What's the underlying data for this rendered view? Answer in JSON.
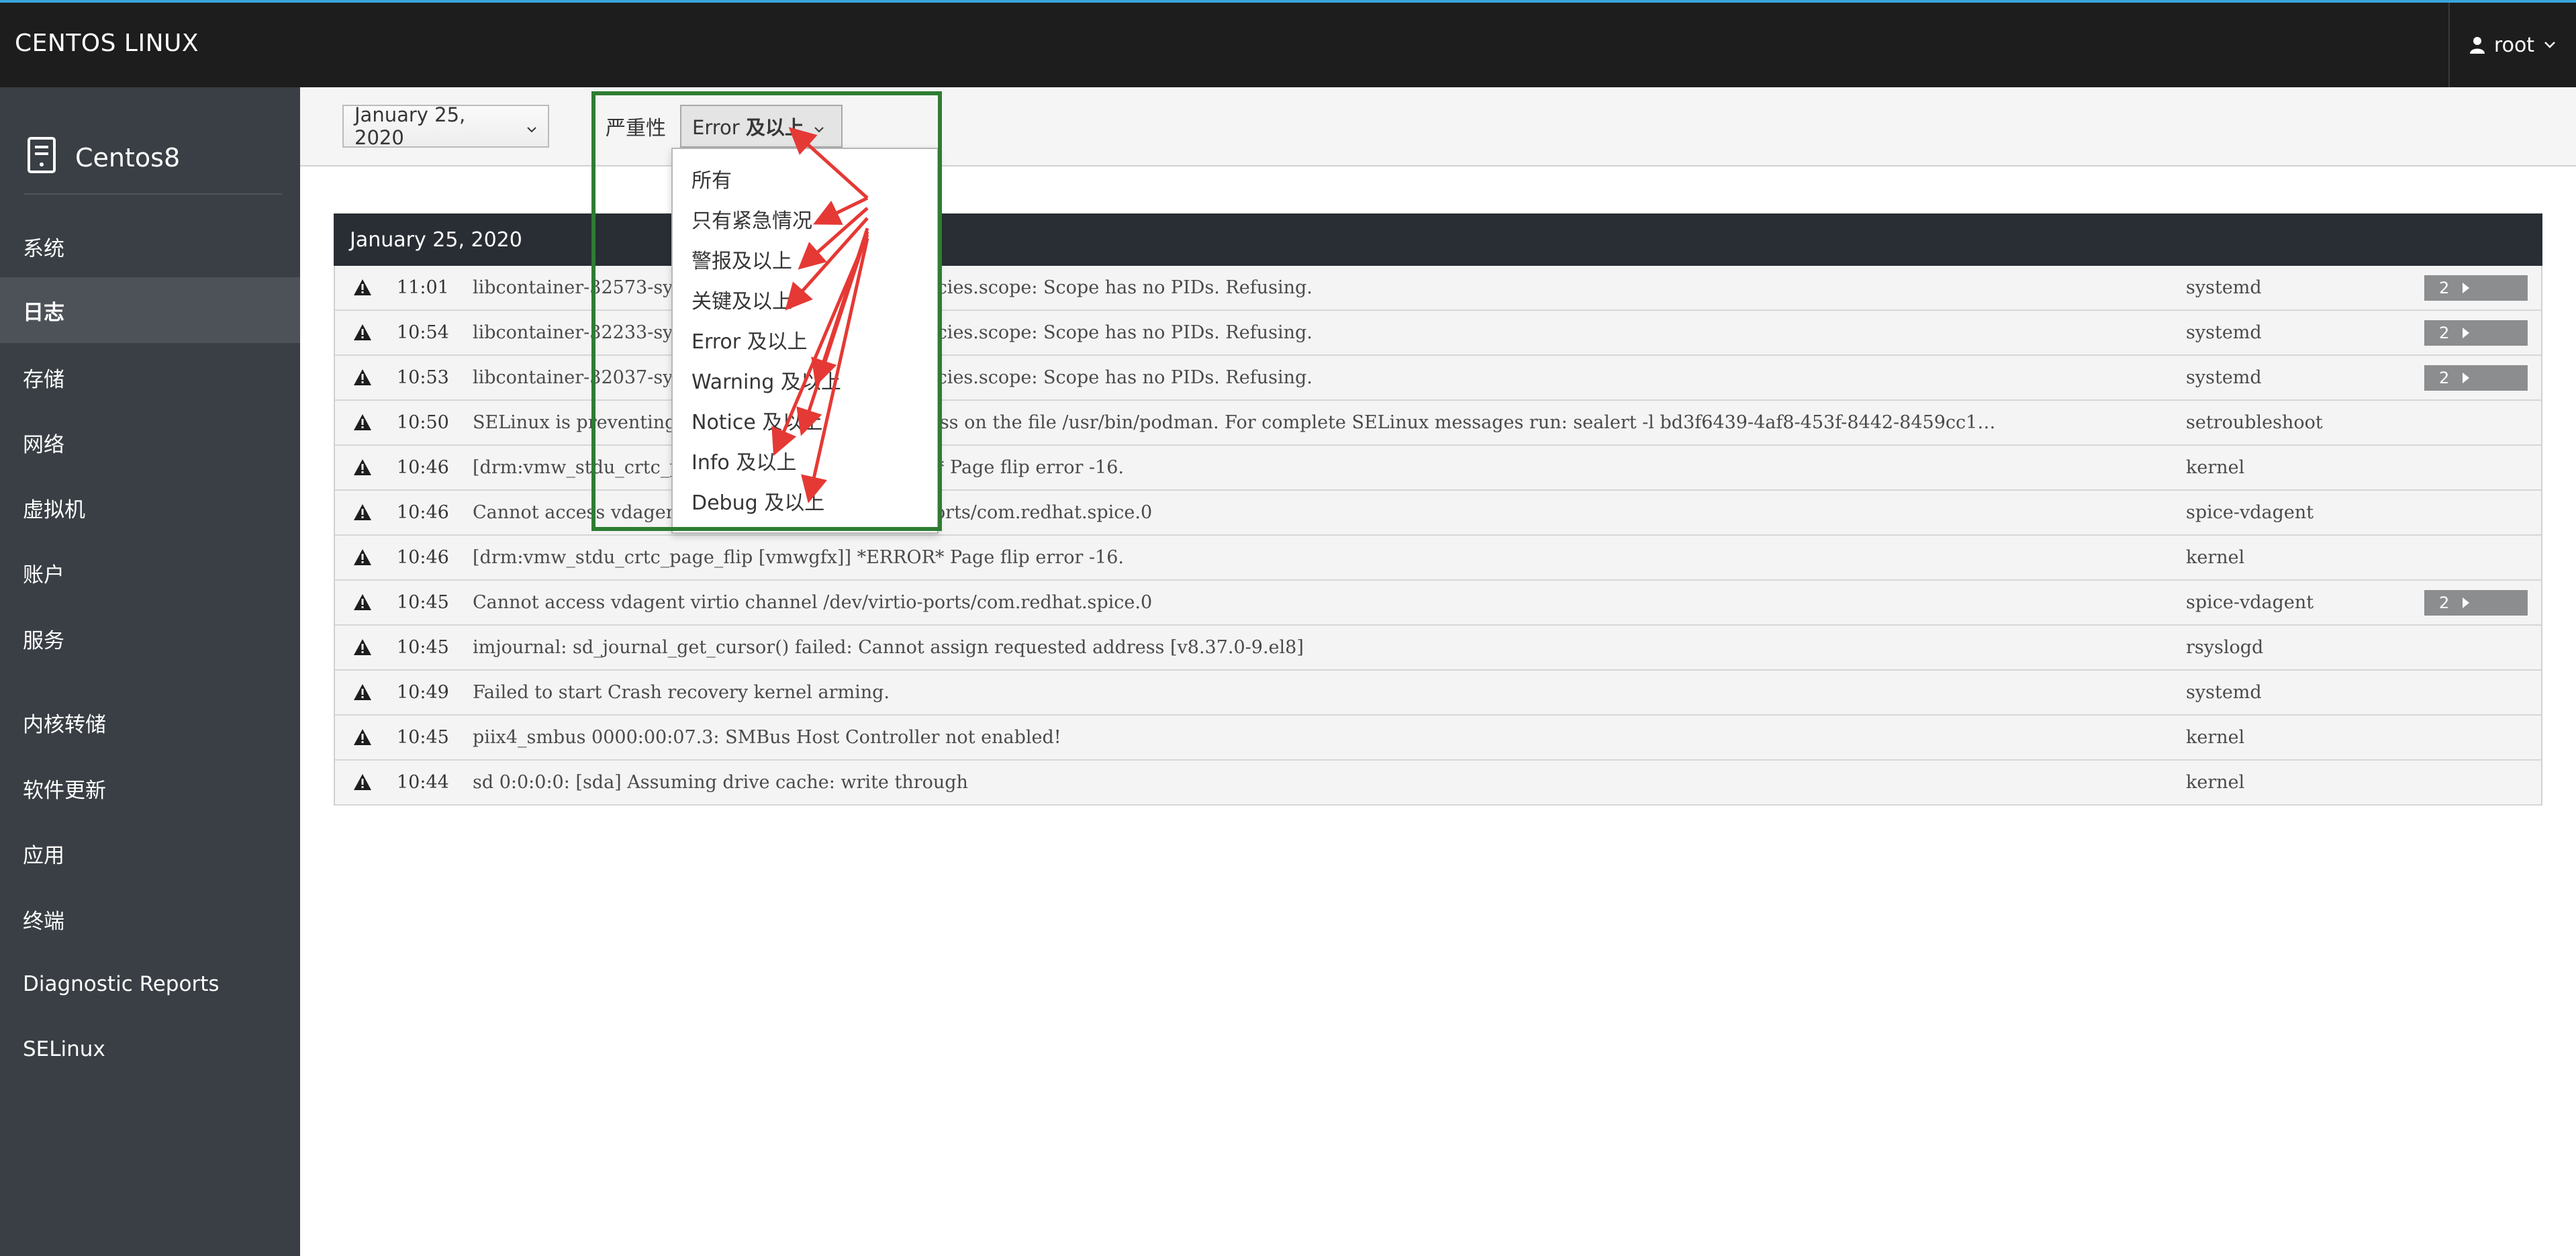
{
  "topbar": {
    "brand": "CENTOS LINUX",
    "user": "root"
  },
  "sidebar": {
    "host": "Centos8",
    "items": [
      {
        "label": "系统"
      },
      {
        "label": "日志",
        "active": true
      },
      {
        "label": "存储"
      },
      {
        "label": "网络"
      },
      {
        "label": "虚拟机"
      },
      {
        "label": "账户"
      },
      {
        "label": "服务"
      },
      {
        "label": "内核转储"
      },
      {
        "label": "软件更新"
      },
      {
        "label": "应用"
      },
      {
        "label": "终端"
      },
      {
        "label": "Diagnostic Reports"
      },
      {
        "label": "SELinux"
      }
    ]
  },
  "filters": {
    "date": "January 25, 2020",
    "severity_label": "严重性",
    "severity_value_en": "Error",
    "severity_value_zh": "及以上"
  },
  "severity_menu": {
    "options": [
      "所有",
      "只有紧急情况",
      "警报及以上",
      "关键及以上",
      "Error 及以上",
      "Warning 及以上",
      "Notice 及以上",
      "Info 及以上",
      "Debug 及以上"
    ]
  },
  "log": {
    "day_header": "January 25, 2020",
    "entries": [
      {
        "time": "11:01",
        "message": "libcontainer-32573-systemd-test-default-dependencies.scope: Scope has no PIDs. Refusing.",
        "identifier": "systemd",
        "count": "2"
      },
      {
        "time": "10:54",
        "message": "libcontainer-32233-systemd-test-default-dependencies.scope: Scope has no PIDs. Refusing.",
        "identifier": "systemd",
        "count": "2"
      },
      {
        "time": "10:53",
        "message": "libcontainer-32037-systemd-test-default-dependencies.scope: Scope has no PIDs. Refusing.",
        "identifier": "systemd",
        "count": "2"
      },
      {
        "time": "10:50",
        "message": "SELinux is preventing podman from mounton access on the file /usr/bin/podman. For complete SELinux messages run: sealert -l bd3f6439-4af8-453f-8442-8459cc1…",
        "identifier": "setroubleshoot",
        "count": ""
      },
      {
        "time": "10:46",
        "message": "[drm:vmw_stdu_crtc_page_flip [vmwgfx]] *ERROR* Page flip error -16.",
        "identifier": "kernel",
        "count": ""
      },
      {
        "time": "10:46",
        "message": "Cannot access vdagent virtio channel /dev/virtio-ports/com.redhat.spice.0",
        "identifier": "spice-vdagent",
        "count": ""
      },
      {
        "time": "10:46",
        "message": "[drm:vmw_stdu_crtc_page_flip [vmwgfx]] *ERROR* Page flip error -16.",
        "identifier": "kernel",
        "count": ""
      },
      {
        "time": "10:45",
        "message": "Cannot access vdagent virtio channel /dev/virtio-ports/com.redhat.spice.0",
        "identifier": "spice-vdagent",
        "count": "2"
      },
      {
        "time": "10:45",
        "message": "imjournal: sd_journal_get_cursor() failed: Cannot assign requested address [v8.37.0-9.el8]",
        "identifier": "rsyslogd",
        "count": ""
      },
      {
        "time": "10:49",
        "message": "Failed to start Crash recovery kernel arming.",
        "identifier": "systemd",
        "count": ""
      },
      {
        "time": "10:45",
        "message": "piix4_smbus 0000:00:07.3: SMBus Host Controller not enabled!",
        "identifier": "kernel",
        "count": ""
      },
      {
        "time": "10:44",
        "message": "sd 0:0:0:0: [sda] Assuming drive cache: write through",
        "identifier": "kernel",
        "count": ""
      }
    ]
  },
  "colors": {
    "topbar": "#1d1d1d",
    "accent": "#39a5dc",
    "sidebar": "#393f44",
    "sidebar_active": "#4d5258",
    "annotation_box": "#2e7d32",
    "annotation_arrow": "#e53935"
  }
}
